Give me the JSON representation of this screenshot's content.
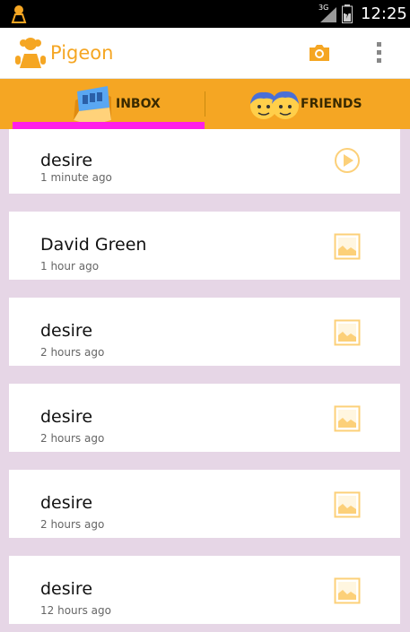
{
  "status_bar": {
    "network": "3G",
    "time": "12:25"
  },
  "app": {
    "title": "Pigeon",
    "accent_color": "#f5a623",
    "indicator_color": "#ff1ee8"
  },
  "tabs": [
    {
      "label": "INBOX",
      "selected": true,
      "icon": "inbox-icon"
    },
    {
      "label": "FRIENDS",
      "selected": false,
      "icon": "friends-icon"
    }
  ],
  "messages": [
    {
      "sender": "desire",
      "time": "1 minute ago",
      "type": "video",
      "icon": "play-icon"
    },
    {
      "sender": "David Green",
      "time": "1 hour ago",
      "type": "image",
      "icon": "image-icon"
    },
    {
      "sender": "desire",
      "time": "2 hours ago",
      "type": "image",
      "icon": "image-icon"
    },
    {
      "sender": "desire",
      "time": "2 hours ago",
      "type": "image",
      "icon": "image-icon"
    },
    {
      "sender": "desire",
      "time": "2 hours ago",
      "type": "image",
      "icon": "image-icon"
    },
    {
      "sender": "desire",
      "time": "12 hours ago",
      "type": "image",
      "icon": "image-icon"
    }
  ]
}
